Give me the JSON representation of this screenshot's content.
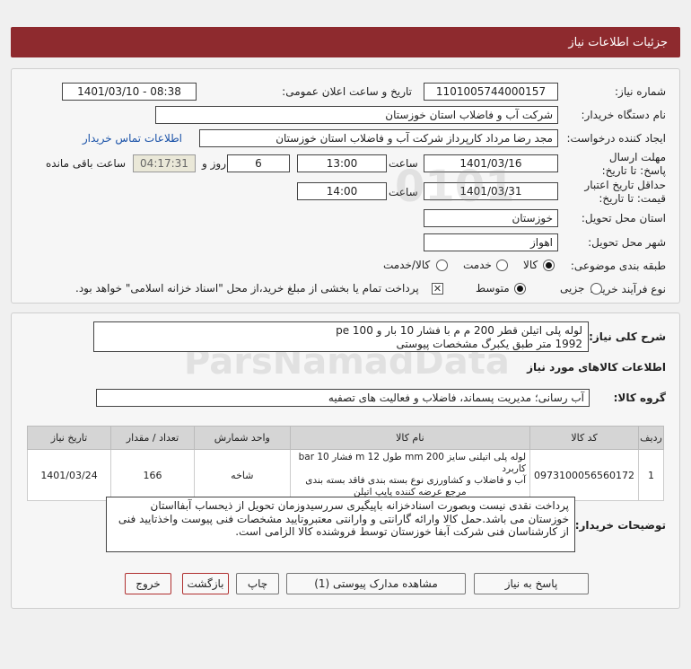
{
  "header": {
    "title": "جزئیات اطلاعات نیاز"
  },
  "fields": {
    "need_number_label": "شماره نیاز:",
    "need_number": "1101005744000157",
    "announce_label": "تاریخ و ساعت اعلان عمومی:",
    "announce_value": "1401/03/10 - 08:38",
    "buyer_org_label": "نام دستگاه خریدار:",
    "buyer_org": "شرکت آب و فاضلاب استان خوزستان",
    "requester_label": "ایجاد کننده درخواست:",
    "requester": "مجد رضا مرداد کارپرداز شرکت آب و فاضلاب استان خوزستان",
    "contact_link": "اطلاعات تماس خریدار",
    "reply_deadline_label": "مهلت ارسال پاسخ: تا تاریخ:",
    "reply_date": "1401/03/16",
    "time_label": "ساعت",
    "reply_time": "13:00",
    "days_value": "6",
    "days_label": "روز و",
    "remaining_time": "04:17:31",
    "remaining_label": "ساعت باقی مانده",
    "validity_label": "حداقل تاریخ اعتبار قیمت: تا تاریخ:",
    "validity_date": "1401/03/31",
    "validity_time": "14:00",
    "province_label": "استان محل تحویل:",
    "province": "خوزستان",
    "city_label": "شهر محل تحویل:",
    "city": "اهواز",
    "category_label": "طبقه بندی موضوعی:",
    "category_options": [
      "کالا",
      "خدمت",
      "کالا/خدمت"
    ],
    "process_label": "نوع فرآیند خرید :",
    "process_options": [
      "جزیی",
      "متوسط"
    ],
    "payment_note": "پرداخت تمام یا بخشی از مبلغ خرید،از محل \"اسناد خزانه اسلامی\" خواهد بود."
  },
  "summary": {
    "label": "شرح کلی نیاز:",
    "line1": "لوله پلی اتیلن قطر 200 م م با فشار 10 بار و pe 100",
    "line2": "1992 متر طبق یکبرگ مشخصات پیوستی"
  },
  "goods": {
    "section_title": "اطلاعات کالاهای مورد نیاز",
    "group_label": "گروه کالا:",
    "group_value": "آب رسانی؛ مدیریت پسماند، فاضلاب و فعالیت های تصفیه",
    "columns": [
      "ردیف",
      "کد کالا",
      "نام کالا",
      "واحد شمارش",
      "تعداد / مقدار",
      "تاریخ نیاز"
    ],
    "rows": [
      {
        "row": "1",
        "code": "0973100056560172",
        "name_line1": "لوله پلی اتیلنی سایز mm 200 طول m 12 فشار bar 10 کاربرد",
        "name_line2": "آب و فاضلاب و کشاورزی نوع بسته بندی فاقد بسته بندی",
        "name_line3": "مرجع عرضه کننده پایپ اتیلن",
        "unit": "شاخه",
        "qty": "166",
        "date": "1401/03/24"
      }
    ]
  },
  "buyer_notes": {
    "label": "توضیحات خریدار:",
    "text": "پرداخت نقدی نیست وبصورت اسنادخزانه باپیگیری سررسیدوزمان تحویل از ذیحساب آبفااستان خوزستان می باشد.حمل کالا وارائه گارانتی و وارانتی معتبروتایید مشخصات فنی پیوست واخذتایید فنی از کارشناسان فنی شرکت آبفا خوزستان توسط فروشنده کالا الزامی است."
  },
  "buttons": {
    "reply": "پاسخ به نیاز",
    "attachments": "مشاهده مدارک پیوستی (1)",
    "print": "چاپ",
    "back": "بازگشت",
    "exit": "خروج"
  },
  "watermark": {
    "brand": "ParsNamadData",
    "digits": "0101"
  },
  "colors": {
    "title_bar": "#8e2a2e",
    "link": "#1a52a8",
    "exit_border": "#b03030"
  }
}
